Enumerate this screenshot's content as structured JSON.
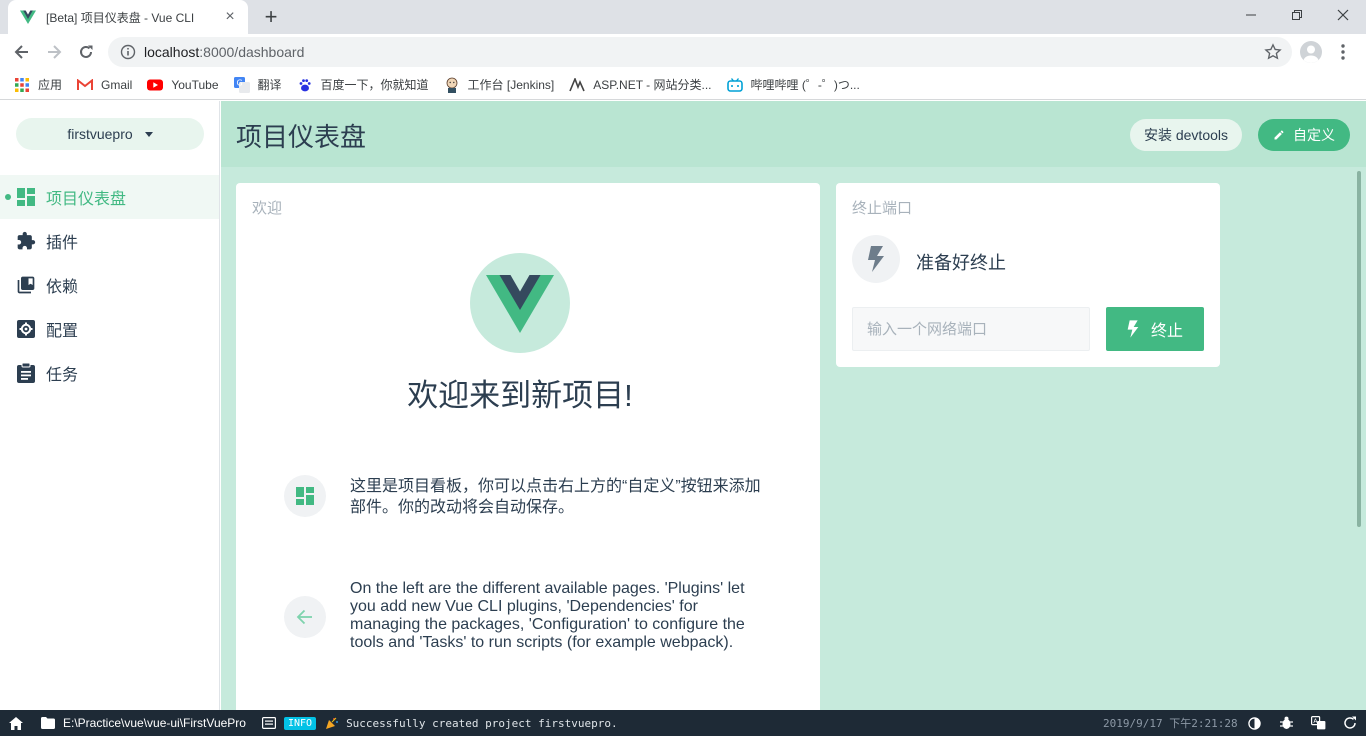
{
  "browser": {
    "tab_title": "[Beta] 项目仪表盘 - Vue CLI",
    "url_host": "localhost",
    "url_rest": ":8000/dashboard",
    "bookmarks": [
      {
        "label": "应用",
        "icon": "apps-grid-icon"
      },
      {
        "label": "Gmail",
        "icon": "gmail-icon"
      },
      {
        "label": "YouTube",
        "icon": "youtube-icon"
      },
      {
        "label": "翻译",
        "icon": "translate-icon"
      },
      {
        "label": "百度一下，你就知道",
        "icon": "baidu-paw-icon"
      },
      {
        "label": "工作台 [Jenkins]",
        "icon": "jenkins-icon"
      },
      {
        "label": "ASP.NET - 网站分类...",
        "icon": "asp-net-icon"
      },
      {
        "label": "哔哩哔哩 (゜-゜)つ...",
        "icon": "bilibili-icon"
      }
    ]
  },
  "sidebar": {
    "project_name": "firstvuepro",
    "items": [
      {
        "label": "项目仪表盘",
        "icon": "dashboard-icon",
        "active": true
      },
      {
        "label": "插件",
        "icon": "puzzle-icon"
      },
      {
        "label": "依赖",
        "icon": "library-books-icon"
      },
      {
        "label": "配置",
        "icon": "settings-icon"
      },
      {
        "label": "任务",
        "icon": "assignment-icon"
      }
    ]
  },
  "header": {
    "title": "项目仪表盘",
    "devtools_label": "安装 devtools",
    "customize_label": "自定义"
  },
  "welcome": {
    "card_title": "欢迎",
    "heading": "欢迎来到新项目!",
    "tip_cn": "这里是项目看板，你可以点击右上方的“自定义”按钮来添加部件。你的改动将会自动保存。",
    "tip_en": "On the left are the different available pages. 'Plugins' let you add new Vue CLI plugins, 'Dependencies' for managing the packages, 'Configuration' to configure the tools and 'Tasks' to run scripts (for example webpack)."
  },
  "kill_port": {
    "card_title": "终止端口",
    "status": "准备好终止",
    "placeholder": "输入一个网络端口",
    "button_label": "终止"
  },
  "statusbar": {
    "path": "E:\\Practice\\vue\\vue-ui\\FirstVuePro",
    "level": "INFO",
    "message": "Successfully created project firstvuepro.",
    "time": "2019/9/17 下午2:21:28"
  },
  "colors": {
    "accent": "#42b983",
    "header_bg": "#b9e5d2",
    "main_bg": "#c6eadc",
    "statusbar_bg": "#1e2a36",
    "info_badge": "#03c2e6"
  }
}
